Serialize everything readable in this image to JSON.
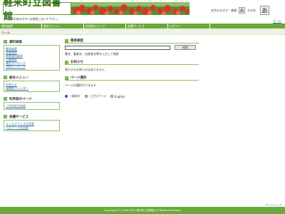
{
  "header": {
    "logo": "軽米町立図書館",
    "note": "ブラウザの戻るボタンは使用しないで下さい。",
    "fontsize_label": "文字の大きさ：普通",
    "fontsize_mid": "あ",
    "fontsize_mid_label": "大きめ",
    "fontsize_big": "あ",
    "top_link": "ホーム"
  },
  "nav": {
    "items": [
      "資料検索",
      "総合メニュー",
      "利用者のページ",
      "各種サービス",
      "ログイン"
    ]
  },
  "breadcrumb": "ホーム",
  "sidebar": {
    "sections": [
      {
        "title": "資料検索",
        "links": [
          "簡易検索",
          "詳細検索",
          "新着資料検索",
          "分類検索",
          "貸出ランキング",
          "予約ランキング"
        ]
      },
      {
        "title": "総合メニュー",
        "links": [
          "お知らせ",
          "図書館カレンダー"
        ]
      },
      {
        "title": "利用者のページ",
        "links": [
          "ご利用状況参照"
        ]
      },
      {
        "title": "各種サービス",
        "links": [
          "メールアドレスの変更",
          "パスワードの変更"
        ]
      }
    ]
  },
  "main": {
    "search": {
      "title": "簡易検索",
      "input_value": "",
      "button": "検索",
      "hint": "書名、著者名、出版者名等を入力して検索"
    },
    "news": {
      "title": "お知らせ",
      "text": "表示するお知らせはありません"
    },
    "page_select": {
      "title": "ページ選択",
      "text": "ページの選択ができます",
      "options": [
        "一般向け",
        "こどもページ",
        "English"
      ],
      "selected": "一般向け"
    }
  },
  "footer": {
    "top_link": "ページトップ",
    "copyright": "Copyright (C) 2000-2010 軽米町立図書館 All Rights Reserved."
  },
  "colors": {
    "accent": "#6aa83c",
    "accent_light": "#8cc263",
    "link": "#3a6ea5"
  }
}
